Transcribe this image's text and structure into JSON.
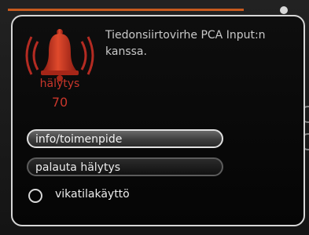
{
  "alarm": {
    "icon": "bell-icon",
    "label": "hälytys",
    "code": "70",
    "color": "#c8362b"
  },
  "message": "Tiedonsiirtovirhe PCA Input:n kanssa.",
  "buttons": {
    "info_label": "info/toimenpide",
    "reset_label": "palauta hälytys"
  },
  "radio": {
    "label": "vikatilakäyttö",
    "checked": false
  },
  "colors": {
    "accent": "#c85a1e",
    "alarm_red": "#c8362b",
    "panel_border": "#d6d6d6"
  }
}
